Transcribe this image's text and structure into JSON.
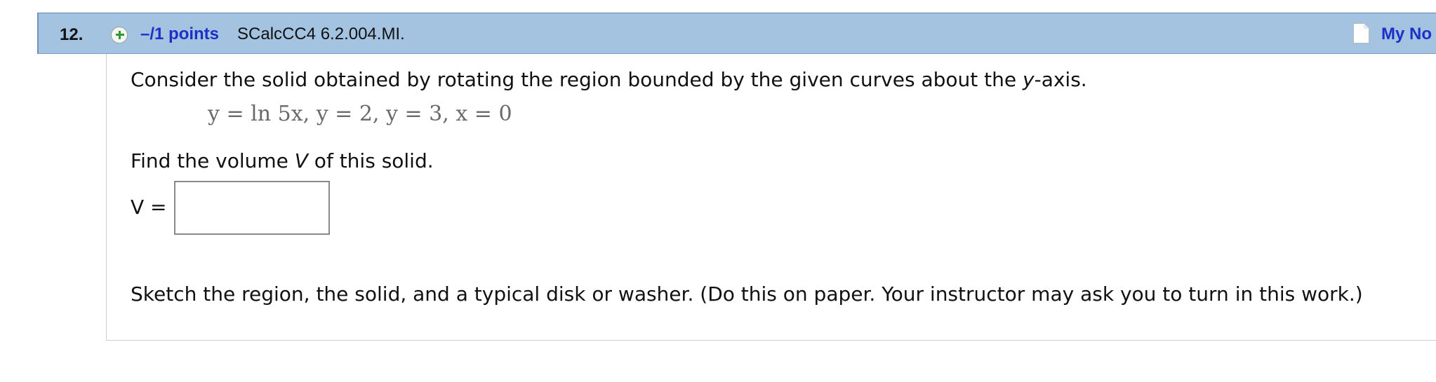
{
  "header": {
    "number": "12.",
    "points": "–/1 points",
    "source": "SCalcCC4 6.2.004.MI.",
    "notes_link": "My No",
    "icons": {
      "add": "plus-circle-icon",
      "notes": "document-icon"
    }
  },
  "question": {
    "prompt_before": "Consider the solid obtained by rotating the region bounded by the given curves about the ",
    "prompt_var": "y",
    "prompt_after": "-axis.",
    "equation": "y = ln 5x,  y = 2,  y = 3,  x = 0",
    "find_before": "Find the volume ",
    "find_var": "V",
    "find_after": " of this solid.",
    "answer_label": "V =",
    "answer_value": "",
    "sketch": "Sketch the region, the solid, and a typical disk or washer. (Do this on paper. Your instructor may ask you to turn in this work.)"
  },
  "colors": {
    "header_bg": "#a3c3e0",
    "link": "#1c30c8",
    "plus_green": "#2e9a2e"
  }
}
